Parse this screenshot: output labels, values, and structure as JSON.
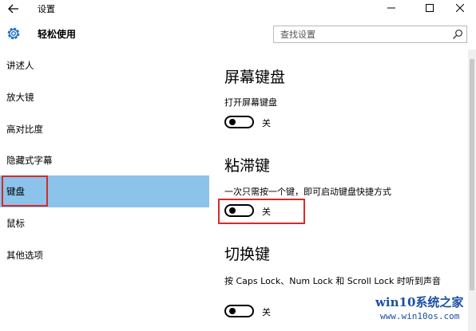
{
  "window": {
    "title": "设置",
    "back_icon": "arrow-left-icon",
    "minimize_icon": "minimize-icon",
    "maximize_icon": "maximize-icon",
    "close_icon": "close-icon"
  },
  "header": {
    "icon": "gear-icon",
    "title": "轻松使用",
    "search_placeholder": "查找设置",
    "search_icon": "search-icon"
  },
  "sidebar": {
    "items": [
      {
        "label": "讲述人"
      },
      {
        "label": "放大镜"
      },
      {
        "label": "高对比度"
      },
      {
        "label": "隐藏式字幕"
      },
      {
        "label": "键盘",
        "selected": true
      },
      {
        "label": "鼠标"
      },
      {
        "label": "其他选项"
      }
    ],
    "selected_color": "#8bc3ea"
  },
  "main": {
    "sections": [
      {
        "title": "屏幕键盘",
        "description": "打开屏幕键盘",
        "toggle_state": "关"
      },
      {
        "title": "粘滞键",
        "description": "一次只需按一个键，即可启动键盘快捷方式",
        "toggle_state": "关"
      },
      {
        "title": "切换键",
        "description": "按 Caps Lock、Num Lock 和 Scroll Lock 时听到声音",
        "toggle_state": "关"
      }
    ]
  },
  "highlight_color": "#d42b2b",
  "watermark": {
    "line1": "win10系统之家",
    "line2": "www.win10os.com"
  }
}
